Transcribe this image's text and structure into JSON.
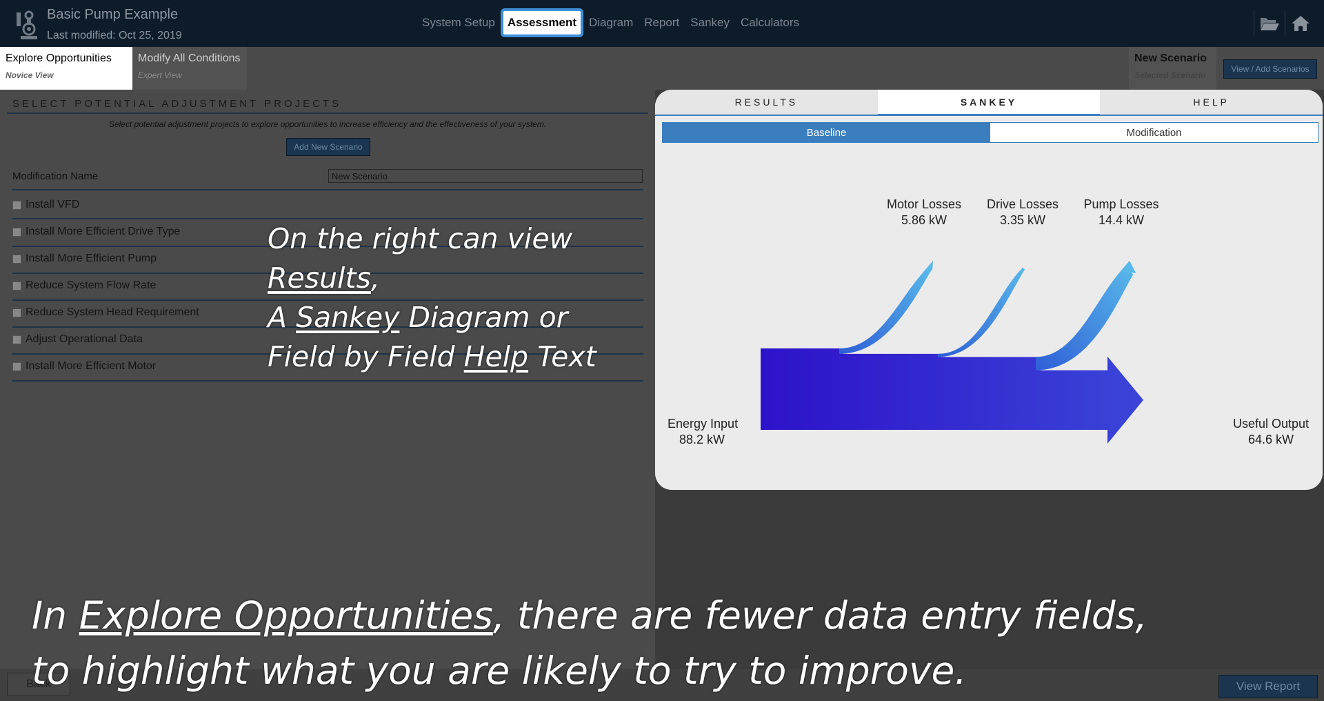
{
  "app": {
    "title": "Basic Pump Example",
    "last_modified": "Last modified: Oct 25, 2019"
  },
  "nav": {
    "tabs": [
      {
        "label": "System Setup",
        "active": false
      },
      {
        "label": "Assessment",
        "active": true
      },
      {
        "label": "Diagram",
        "active": false
      },
      {
        "label": "Report",
        "active": false
      },
      {
        "label": "Sankey",
        "active": false
      },
      {
        "label": "Calculators",
        "active": false
      }
    ]
  },
  "icons": {
    "folder": "folder-open-icon",
    "home": "home-icon",
    "logo": "pump-logo-icon"
  },
  "view_tabs": {
    "explore": {
      "title": "Explore Opportunities",
      "subtitle": "Novice View"
    },
    "modify": {
      "title": "Modify All Conditions",
      "subtitle": "Expert View"
    }
  },
  "scenario": {
    "name": "New Scenario",
    "subtitle": "Selected Scenario",
    "view_add_label": "View / Add Scenarios"
  },
  "form": {
    "section_title": "SELECT POTENTIAL ADJUSTMENT PROJECTS",
    "intro": "Select potential adjustment projects to explore opportunities to increase efficiency and the effectiveness of your system.",
    "add_scenario_label": "Add New Scenario",
    "mod_name_label": "Modification Name",
    "mod_name_value": "New Scenario",
    "options": [
      {
        "label": "Install VFD",
        "checked": false
      },
      {
        "label": "Install More Efficient Drive Type",
        "checked": false
      },
      {
        "label": "Install More Efficient Pump",
        "checked": false
      },
      {
        "label": "Reduce System Flow Rate",
        "checked": false
      },
      {
        "label": "Reduce System Head Requirement",
        "checked": false
      },
      {
        "label": "Adjust Operational Data",
        "checked": false
      },
      {
        "label": "Install More Efficient Motor",
        "checked": false
      }
    ]
  },
  "results_panel": {
    "tabs": [
      {
        "label": "RESULTS",
        "active": false
      },
      {
        "label": "SANKEY",
        "active": true
      },
      {
        "label": "HELP",
        "active": false
      }
    ],
    "toggle": {
      "baseline": "Baseline",
      "modification": "Modification",
      "active": "baseline"
    }
  },
  "sankey": {
    "input": {
      "name": "Energy Input",
      "value": "88.2 kW",
      "kw": 88.2
    },
    "losses": [
      {
        "name": "Motor Losses",
        "value": "5.86 kW",
        "kw": 5.86
      },
      {
        "name": "Drive Losses",
        "value": "3.35 kW",
        "kw": 3.35
      },
      {
        "name": "Pump Losses",
        "value": "14.4 kW",
        "kw": 14.4
      }
    ],
    "output": {
      "name": "Useful Output",
      "value": "64.6 kW",
      "kw": 64.6
    },
    "colors": {
      "main_start": "#2d12c9",
      "main_end": "#3b45d8",
      "loss_start": "#2e5fd6",
      "loss_end": "#58b8ea"
    }
  },
  "footer": {
    "back_label": "Back",
    "view_report_label": "View Report"
  },
  "overlays": {
    "right": [
      {
        "pre": "On the right can view",
        "link": "",
        "post": ""
      },
      {
        "pre": "",
        "link": "Results",
        "post": ","
      },
      {
        "pre": "A ",
        "link": "Sankey",
        "post": " Diagram or"
      },
      {
        "pre": "Field by Field ",
        "link": "Help",
        "post": " Text"
      }
    ],
    "bottom": [
      {
        "pre": "In ",
        "link": "Explore Opportunities",
        "post": ", there are fewer data entry fields,"
      },
      {
        "pre": "to highlight what you are likely to try to improve.",
        "link": "",
        "post": ""
      }
    ]
  }
}
